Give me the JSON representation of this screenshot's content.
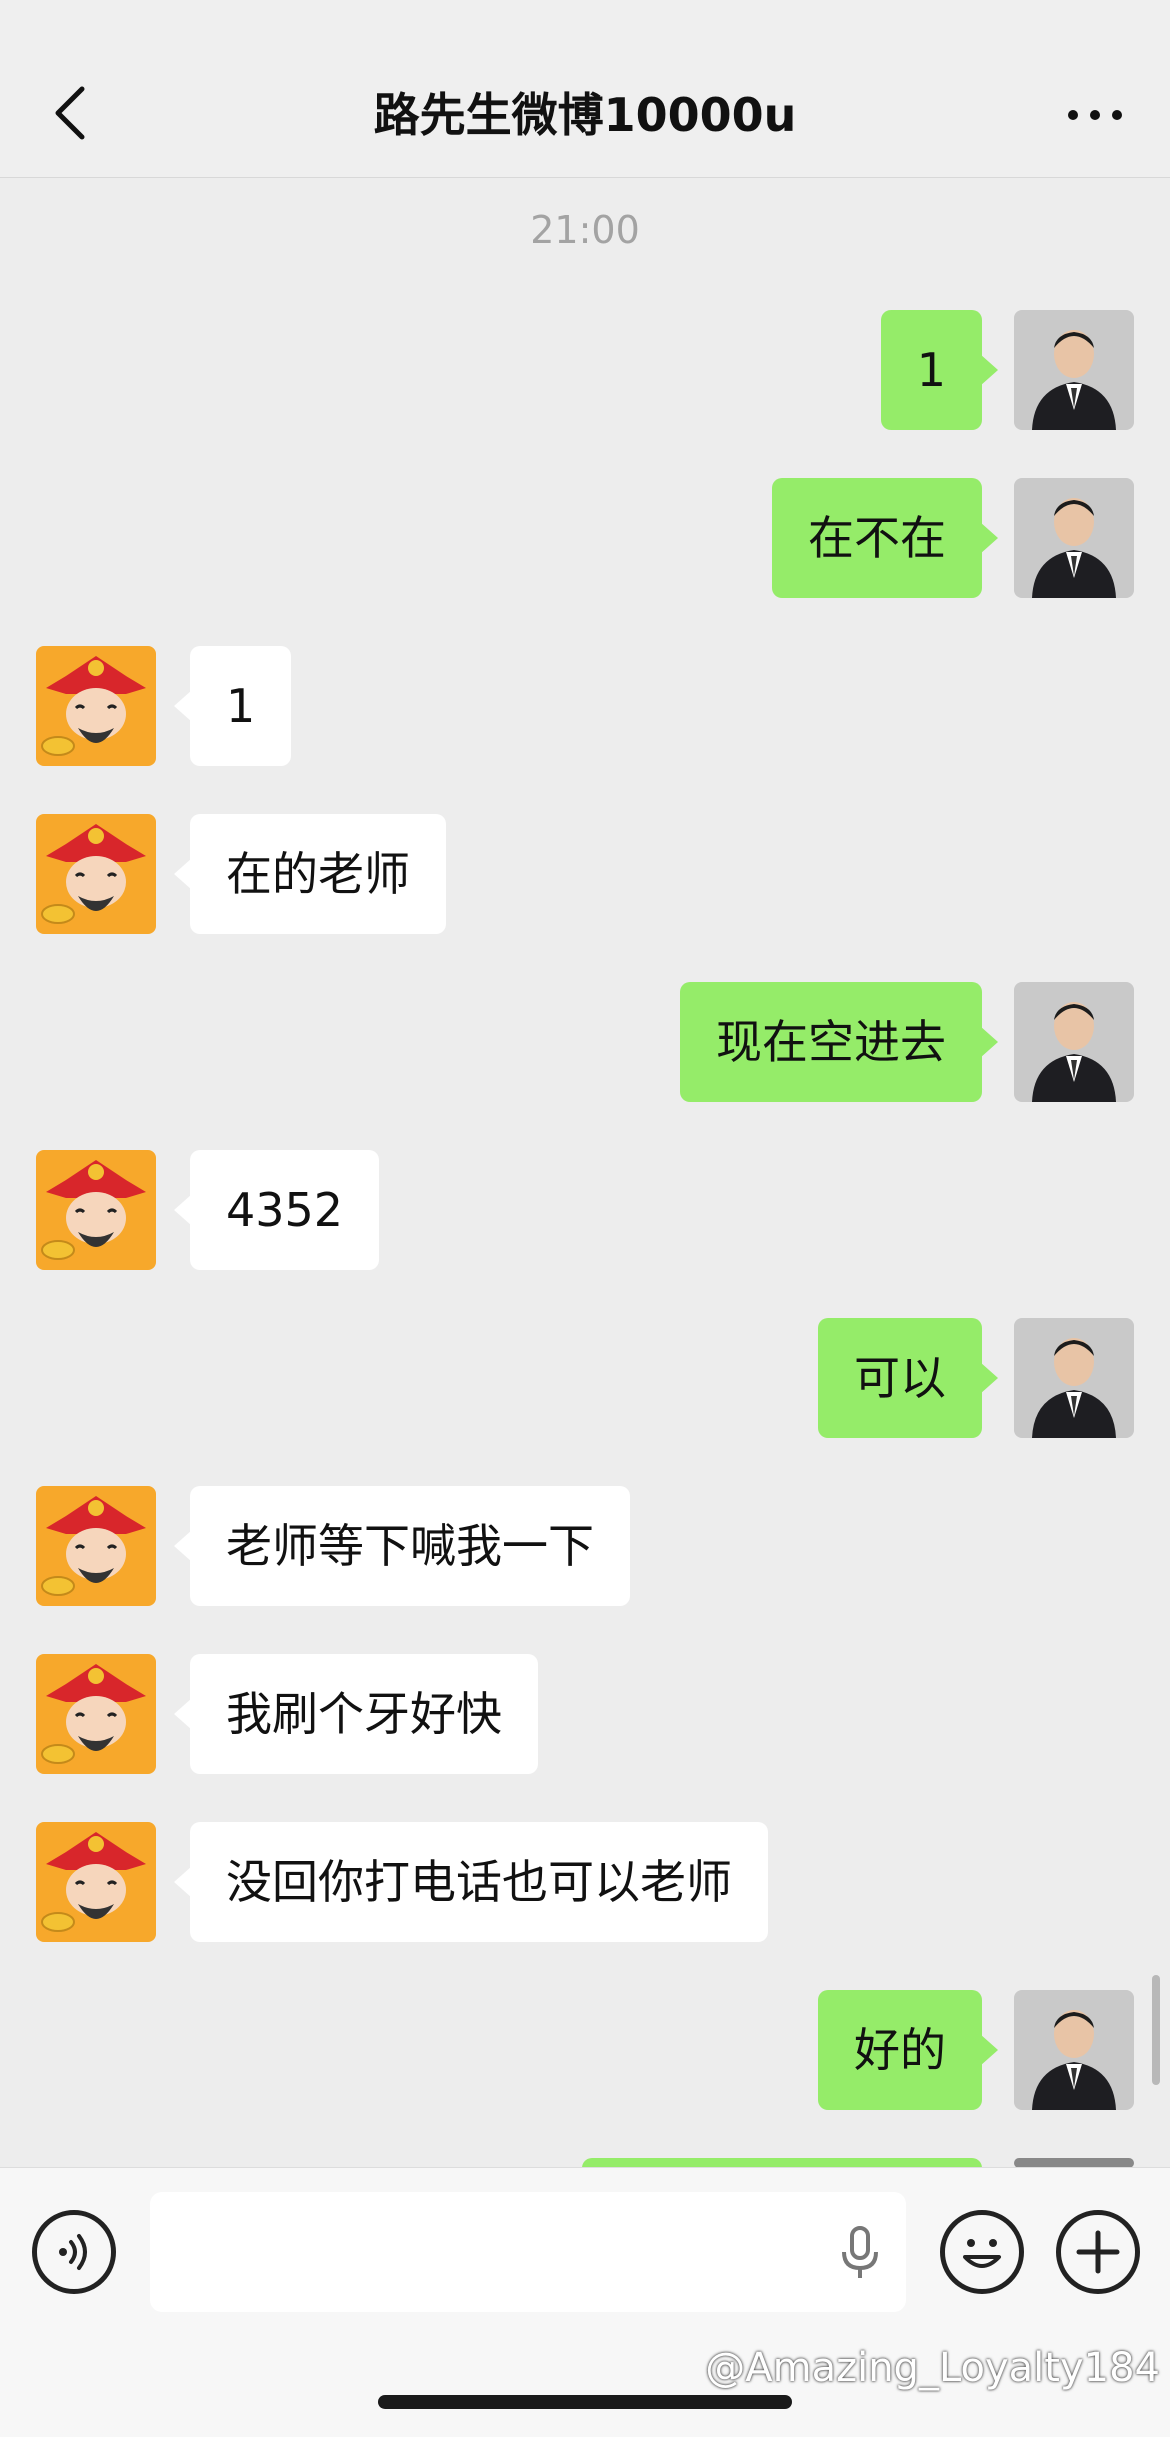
{
  "header": {
    "title": "路先生微博10000u",
    "back_icon": "chevron-left-icon",
    "more_icon": "more-dots-icon"
  },
  "chat": {
    "timestamp": "21:00",
    "messages": [
      {
        "side": "me",
        "text": "1"
      },
      {
        "side": "me",
        "text": "在不在"
      },
      {
        "side": "other",
        "text": "1"
      },
      {
        "side": "other",
        "text": "在的老师"
      },
      {
        "side": "me",
        "text": "现在空进去"
      },
      {
        "side": "other",
        "text": "4352"
      },
      {
        "side": "me",
        "text": "可以"
      },
      {
        "side": "other",
        "text": "老师等下喊我一下"
      },
      {
        "side": "other",
        "text": "我刷个牙好快"
      },
      {
        "side": "other",
        "text": "没回你打电话也可以老师"
      },
      {
        "side": "me",
        "text": "好的"
      }
    ]
  },
  "input_bar": {
    "voice_icon": "voice-icon",
    "mic_icon": "microphone-icon",
    "emoji_icon": "emoji-icon",
    "plus_icon": "plus-icon"
  },
  "colors": {
    "me_bubble": "#95ec69",
    "other_bubble": "#ffffff",
    "background": "#ededed"
  },
  "watermark": "@Amazing_Loyalty184"
}
